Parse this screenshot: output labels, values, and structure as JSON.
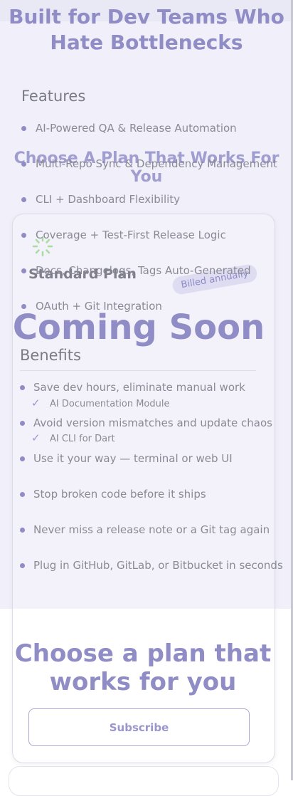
{
  "hero": {
    "title": "Built for Dev Teams Who Hate Bottlenecks"
  },
  "features": {
    "title": "Features",
    "items": [
      "AI-Powered QA & Release Automation",
      "Multi-Repo Sync & Dependency Management",
      "CLI + Dashboard Flexibility",
      "Coverage + Test-First Release Logic",
      "Docs, Changelogs, Tags Auto-Generated",
      "OAuth + Git Integration"
    ]
  },
  "plans": {
    "heading": "Choose A Plan That Works For You",
    "plan_name": "Standard Plan",
    "billing_badge": "Billed annually",
    "status": "Coming Soon",
    "included_modules": [
      "AI Documentation Module",
      "AI CLI for Dart"
    ]
  },
  "benefits": {
    "title": "Benefits",
    "items": [
      "Save dev hours, eliminate manual work",
      "Avoid version mismatches and update chaos",
      "Use it your way — terminal or web UI",
      "Stop broken code before it ships",
      "Never miss a release note or a Git tag again",
      "Plug in GitHub, GitLab, or Bitbucket in seconds"
    ]
  },
  "cta": {
    "title": "Choose a plan that works for you",
    "subscribe_label": "Subscribe"
  },
  "colors": {
    "accent": "#8f8cc6",
    "band": "#f1f0fa",
    "text": "#8a8a96"
  }
}
